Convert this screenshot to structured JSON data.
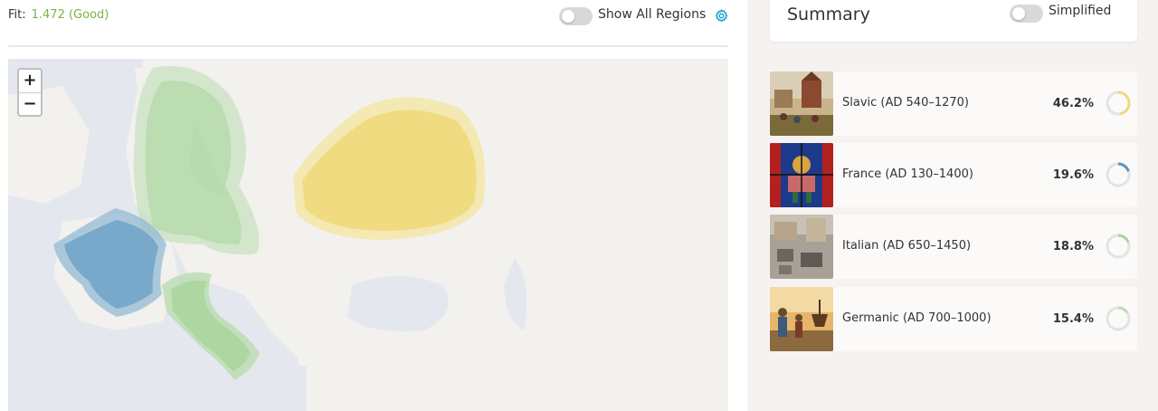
{
  "fit": {
    "label": "Fit:",
    "value": "1.472 (Good)",
    "value_color": "#7cb342"
  },
  "controls": {
    "show_all_regions_label": "Show All Regions",
    "show_all_regions_on": false,
    "settings_icon": "gear-icon"
  },
  "map": {
    "zoom_in": "+",
    "zoom_out": "−"
  },
  "summary": {
    "title": "Summary",
    "simplified_label": "Simplified",
    "simplified_on": false
  },
  "populations": [
    {
      "name": "Slavic (AD 540–1270)",
      "percent": "46.2%",
      "fraction": 0.462,
      "color": "#f0d97a"
    },
    {
      "name": "France (AD 130–1400)",
      "percent": "19.6%",
      "fraction": 0.196,
      "color": "#5b95bf"
    },
    {
      "name": "Italian (AD 650–1450)",
      "percent": "18.8%",
      "fraction": 0.188,
      "color": "#a9d39a"
    },
    {
      "name": "Germanic (AD 700–1000)",
      "percent": "15.4%",
      "fraction": 0.154,
      "color": "#b9dcb0"
    }
  ]
}
